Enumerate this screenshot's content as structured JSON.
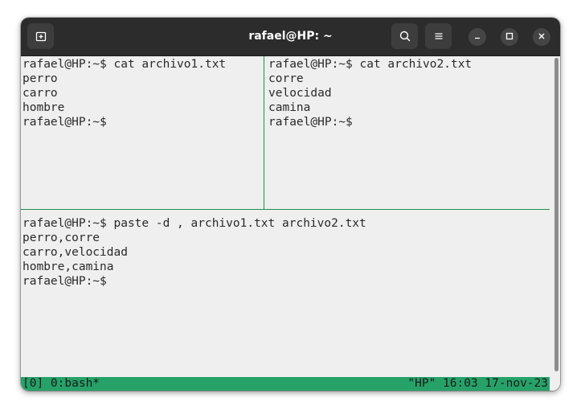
{
  "window": {
    "title": "rafael@HP: ~"
  },
  "icons": {
    "new_tab": "new-tab-icon",
    "search": "search-icon",
    "menu": "hamburger-menu-icon",
    "minimize": "minimize-icon",
    "maximize": "maximize-icon",
    "close": "close-icon"
  },
  "panes": {
    "left": {
      "lines": [
        "rafael@HP:~$ cat archivo1.txt",
        "perro",
        "carro",
        "hombre",
        "rafael@HP:~$"
      ]
    },
    "right": {
      "lines": [
        "rafael@HP:~$ cat archivo2.txt",
        "corre",
        "velocidad",
        "camina",
        "rafael@HP:~$"
      ]
    },
    "bottom": {
      "lines": [
        "rafael@HP:~$ paste -d , archivo1.txt archivo2.txt",
        "perro,corre",
        "carro,velocidad",
        "hombre,camina",
        "rafael@HP:~$"
      ]
    }
  },
  "statusbar": {
    "left": "[0] 0:bash*",
    "right": "\"HP\" 16:03 17-nov-23"
  },
  "colors": {
    "headerbar": "#2c2c2c",
    "terminal_bg": "#efefef",
    "tmux_accent": "#26a269"
  }
}
